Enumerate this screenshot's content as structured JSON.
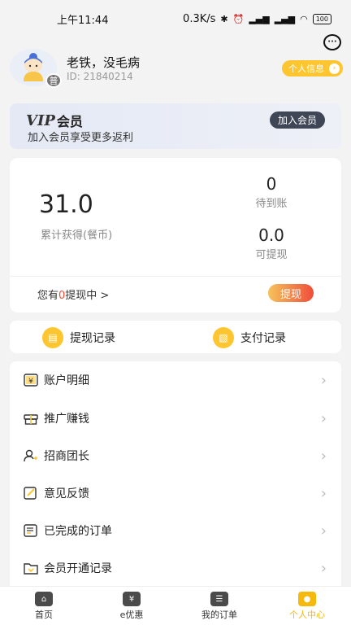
{
  "status_bar": {
    "time": "上午11:44",
    "speed": "0.3K/s",
    "battery": "100"
  },
  "profile": {
    "username": "老铁，没毛病",
    "user_id": "ID: 21840214",
    "level_badge": "普",
    "info_button": "个人信息"
  },
  "vip": {
    "logo": "VIP",
    "title": "会员",
    "subtitle": "加入会员享受更多返利",
    "join_button": "加入会员"
  },
  "earnings": {
    "total_value": "31.0",
    "total_label": "累计获得(餐币)",
    "pending_value": "0",
    "pending_label": "待到账",
    "available_value": "0.0",
    "available_label": "可提现",
    "withdrawing_prefix": "您有",
    "withdrawing_count": "0",
    "withdrawing_suffix": "提现中 >",
    "withdraw_button": "提现"
  },
  "records": {
    "withdraw_record": "提现记录",
    "payment_record": "支付记录"
  },
  "menu": {
    "items": [
      {
        "label": "账户明细",
        "icon": "yen-card-icon"
      },
      {
        "label": "推广赚钱",
        "icon": "gift-icon"
      },
      {
        "label": "招商团长",
        "icon": "user-add-icon"
      },
      {
        "label": "意见反馈",
        "icon": "edit-icon"
      },
      {
        "label": "已完成的订单",
        "icon": "order-list-icon"
      },
      {
        "label": "会员开通记录",
        "icon": "folder-icon"
      }
    ]
  },
  "tabbar": {
    "home": "首页",
    "discount": "e优惠",
    "orders": "我的订单",
    "profile": "个人中心"
  },
  "colors": {
    "accent": "#fdc631",
    "active_tab": "#f5b80d",
    "withdraw_gradient_start": "#f6c35a",
    "withdraw_gradient_end": "#ef4d3a",
    "vip_button": "#3f4656"
  }
}
